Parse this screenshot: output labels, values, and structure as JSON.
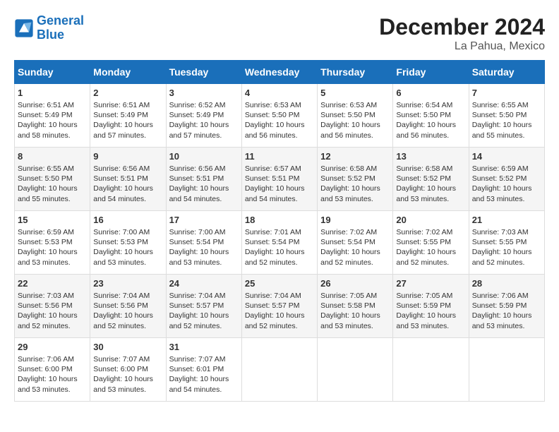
{
  "logo": {
    "line1": "General",
    "line2": "Blue"
  },
  "title": "December 2024",
  "location": "La Pahua, Mexico",
  "days_header": [
    "Sunday",
    "Monday",
    "Tuesday",
    "Wednesday",
    "Thursday",
    "Friday",
    "Saturday"
  ],
  "weeks": [
    [
      {
        "num": "1",
        "sunrise": "6:51 AM",
        "sunset": "5:49 PM",
        "daylight": "10 hours and 58 minutes."
      },
      {
        "num": "2",
        "sunrise": "6:51 AM",
        "sunset": "5:49 PM",
        "daylight": "10 hours and 57 minutes."
      },
      {
        "num": "3",
        "sunrise": "6:52 AM",
        "sunset": "5:49 PM",
        "daylight": "10 hours and 57 minutes."
      },
      {
        "num": "4",
        "sunrise": "6:53 AM",
        "sunset": "5:50 PM",
        "daylight": "10 hours and 56 minutes."
      },
      {
        "num": "5",
        "sunrise": "6:53 AM",
        "sunset": "5:50 PM",
        "daylight": "10 hours and 56 minutes."
      },
      {
        "num": "6",
        "sunrise": "6:54 AM",
        "sunset": "5:50 PM",
        "daylight": "10 hours and 56 minutes."
      },
      {
        "num": "7",
        "sunrise": "6:55 AM",
        "sunset": "5:50 PM",
        "daylight": "10 hours and 55 minutes."
      }
    ],
    [
      {
        "num": "8",
        "sunrise": "6:55 AM",
        "sunset": "5:50 PM",
        "daylight": "10 hours and 55 minutes."
      },
      {
        "num": "9",
        "sunrise": "6:56 AM",
        "sunset": "5:51 PM",
        "daylight": "10 hours and 54 minutes."
      },
      {
        "num": "10",
        "sunrise": "6:56 AM",
        "sunset": "5:51 PM",
        "daylight": "10 hours and 54 minutes."
      },
      {
        "num": "11",
        "sunrise": "6:57 AM",
        "sunset": "5:51 PM",
        "daylight": "10 hours and 54 minutes."
      },
      {
        "num": "12",
        "sunrise": "6:58 AM",
        "sunset": "5:52 PM",
        "daylight": "10 hours and 53 minutes."
      },
      {
        "num": "13",
        "sunrise": "6:58 AM",
        "sunset": "5:52 PM",
        "daylight": "10 hours and 53 minutes."
      },
      {
        "num": "14",
        "sunrise": "6:59 AM",
        "sunset": "5:52 PM",
        "daylight": "10 hours and 53 minutes."
      }
    ],
    [
      {
        "num": "15",
        "sunrise": "6:59 AM",
        "sunset": "5:53 PM",
        "daylight": "10 hours and 53 minutes."
      },
      {
        "num": "16",
        "sunrise": "7:00 AM",
        "sunset": "5:53 PM",
        "daylight": "10 hours and 53 minutes."
      },
      {
        "num": "17",
        "sunrise": "7:00 AM",
        "sunset": "5:54 PM",
        "daylight": "10 hours and 53 minutes."
      },
      {
        "num": "18",
        "sunrise": "7:01 AM",
        "sunset": "5:54 PM",
        "daylight": "10 hours and 52 minutes."
      },
      {
        "num": "19",
        "sunrise": "7:02 AM",
        "sunset": "5:54 PM",
        "daylight": "10 hours and 52 minutes."
      },
      {
        "num": "20",
        "sunrise": "7:02 AM",
        "sunset": "5:55 PM",
        "daylight": "10 hours and 52 minutes."
      },
      {
        "num": "21",
        "sunrise": "7:03 AM",
        "sunset": "5:55 PM",
        "daylight": "10 hours and 52 minutes."
      }
    ],
    [
      {
        "num": "22",
        "sunrise": "7:03 AM",
        "sunset": "5:56 PM",
        "daylight": "10 hours and 52 minutes."
      },
      {
        "num": "23",
        "sunrise": "7:04 AM",
        "sunset": "5:56 PM",
        "daylight": "10 hours and 52 minutes."
      },
      {
        "num": "24",
        "sunrise": "7:04 AM",
        "sunset": "5:57 PM",
        "daylight": "10 hours and 52 minutes."
      },
      {
        "num": "25",
        "sunrise": "7:04 AM",
        "sunset": "5:57 PM",
        "daylight": "10 hours and 52 minutes."
      },
      {
        "num": "26",
        "sunrise": "7:05 AM",
        "sunset": "5:58 PM",
        "daylight": "10 hours and 53 minutes."
      },
      {
        "num": "27",
        "sunrise": "7:05 AM",
        "sunset": "5:59 PM",
        "daylight": "10 hours and 53 minutes."
      },
      {
        "num": "28",
        "sunrise": "7:06 AM",
        "sunset": "5:59 PM",
        "daylight": "10 hours and 53 minutes."
      }
    ],
    [
      {
        "num": "29",
        "sunrise": "7:06 AM",
        "sunset": "6:00 PM",
        "daylight": "10 hours and 53 minutes."
      },
      {
        "num": "30",
        "sunrise": "7:07 AM",
        "sunset": "6:00 PM",
        "daylight": "10 hours and 53 minutes."
      },
      {
        "num": "31",
        "sunrise": "7:07 AM",
        "sunset": "6:01 PM",
        "daylight": "10 hours and 54 minutes."
      },
      null,
      null,
      null,
      null
    ]
  ]
}
